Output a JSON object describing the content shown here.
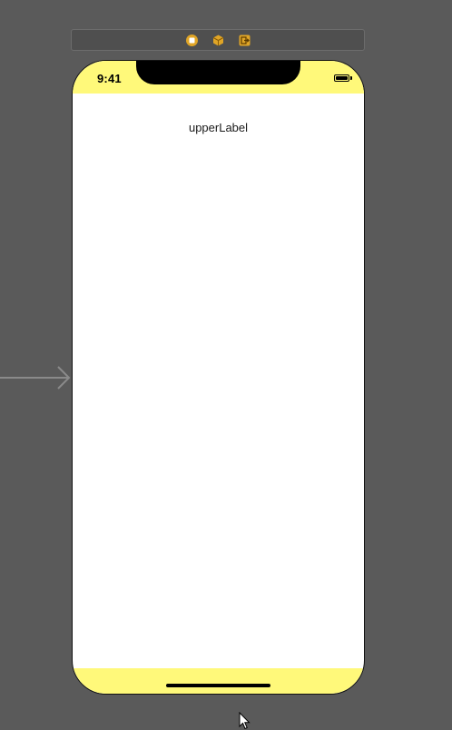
{
  "scene_dock": {
    "icons": [
      "view-controller-icon",
      "first-responder-icon",
      "exit-icon"
    ],
    "accent_color": "#e0a526"
  },
  "device": {
    "status_bar": {
      "time": "9:41",
      "battery_level": 1.0
    },
    "safe_area_color": "#fff97a",
    "background_color": "#ffffff",
    "upper_label": "upperLabel"
  }
}
